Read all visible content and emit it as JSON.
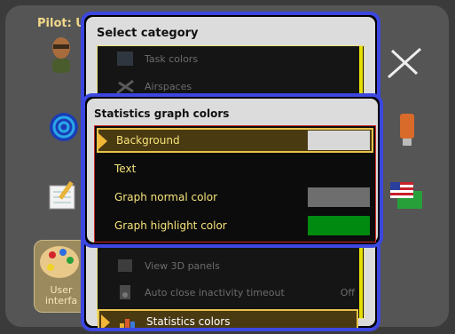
{
  "pilot_label": "Pilot: U",
  "user_tile_label": "User\ninterfa",
  "back_dialog": {
    "title": "Select category",
    "items": [
      {
        "label": "Task colors",
        "icon": "task-colors-icon",
        "value": ""
      },
      {
        "label": "Airspaces",
        "icon": "airspaces-icon",
        "value": ""
      },
      {
        "label": "View 3D panels",
        "icon": "view-3d-icon",
        "value": ""
      },
      {
        "label": "Auto close inactivity timeout",
        "icon": "timer-icon",
        "value": "Off"
      },
      {
        "label": "Statistics colors",
        "icon": "statistics-icon",
        "value": ""
      }
    ]
  },
  "front_dialog": {
    "title": "Statistics graph colors",
    "items": [
      {
        "label": "Background",
        "swatch_color": "#d8d8d8",
        "selected": true
      },
      {
        "label": "Text",
        "swatch_color": "",
        "selected": false
      },
      {
        "label": "Graph normal color",
        "swatch_color": "#6e6e6e",
        "selected": false
      },
      {
        "label": "Graph highlight color",
        "swatch_color": "#008a0f",
        "selected": false
      }
    ]
  },
  "colors": {
    "accent_border": "#3c47e0",
    "selection_border": "#e8c24a",
    "item_text": "#f6e37a"
  }
}
